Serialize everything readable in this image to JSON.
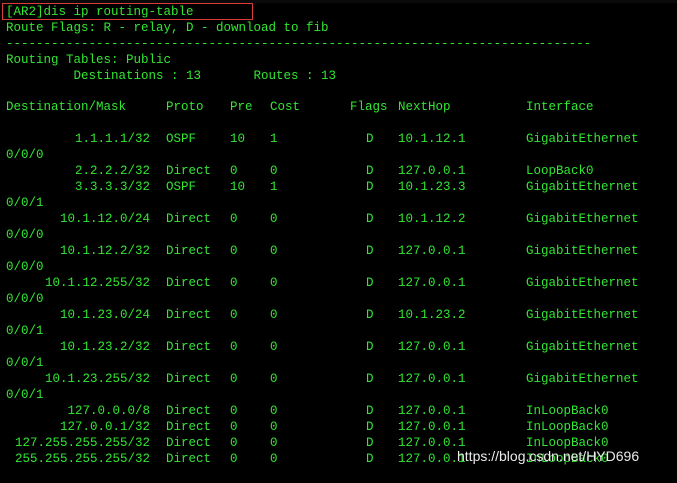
{
  "command": "[AR2]dis ip routing-table",
  "route_flags": "Route Flags: R - relay, D - download to fib",
  "separator": "------------------------------------------------------------------------------",
  "routing_tables": "Routing Tables: Public",
  "destinations_line": "         Destinations : 13       Routes : 13",
  "headers": {
    "destination": "Destination/Mask",
    "proto": "Proto",
    "pre": "Pre",
    "cost": "Cost",
    "flags": "Flags",
    "nexthop": "NextHop",
    "interface": "Interface"
  },
  "rows": [
    {
      "dest": "1.1.1.1/32",
      "proto": "OSPF",
      "pre": "10",
      "cost": "1",
      "flags": "D",
      "nexthop": "10.1.12.1",
      "iface": "GigabitEthernet",
      "cont": "0/0/0"
    },
    {
      "dest": "2.2.2.2/32",
      "proto": "Direct",
      "pre": "0",
      "cost": "0",
      "flags": "D",
      "nexthop": "127.0.0.1",
      "iface": "LoopBack0",
      "cont": ""
    },
    {
      "dest": "3.3.3.3/32",
      "proto": "OSPF",
      "pre": "10",
      "cost": "1",
      "flags": "D",
      "nexthop": "10.1.23.3",
      "iface": "GigabitEthernet",
      "cont": "0/0/1"
    },
    {
      "dest": "10.1.12.0/24",
      "proto": "Direct",
      "pre": "0",
      "cost": "0",
      "flags": "D",
      "nexthop": "10.1.12.2",
      "iface": "GigabitEthernet",
      "cont": "0/0/0"
    },
    {
      "dest": "10.1.12.2/32",
      "proto": "Direct",
      "pre": "0",
      "cost": "0",
      "flags": "D",
      "nexthop": "127.0.0.1",
      "iface": "GigabitEthernet",
      "cont": "0/0/0"
    },
    {
      "dest": "10.1.12.255/32",
      "proto": "Direct",
      "pre": "0",
      "cost": "0",
      "flags": "D",
      "nexthop": "127.0.0.1",
      "iface": "GigabitEthernet",
      "cont": "0/0/0"
    },
    {
      "dest": "10.1.23.0/24",
      "proto": "Direct",
      "pre": "0",
      "cost": "0",
      "flags": "D",
      "nexthop": "10.1.23.2",
      "iface": "GigabitEthernet",
      "cont": "0/0/1"
    },
    {
      "dest": "10.1.23.2/32",
      "proto": "Direct",
      "pre": "0",
      "cost": "0",
      "flags": "D",
      "nexthop": "127.0.0.1",
      "iface": "GigabitEthernet",
      "cont": "0/0/1"
    },
    {
      "dest": "10.1.23.255/32",
      "proto": "Direct",
      "pre": "0",
      "cost": "0",
      "flags": "D",
      "nexthop": "127.0.0.1",
      "iface": "GigabitEthernet",
      "cont": "0/0/1"
    },
    {
      "dest": "127.0.0.0/8",
      "proto": "Direct",
      "pre": "0",
      "cost": "0",
      "flags": "D",
      "nexthop": "127.0.0.1",
      "iface": "InLoopBack0",
      "cont": ""
    },
    {
      "dest": "127.0.0.1/32",
      "proto": "Direct",
      "pre": "0",
      "cost": "0",
      "flags": "D",
      "nexthop": "127.0.0.1",
      "iface": "InLoopBack0",
      "cont": ""
    },
    {
      "dest": "127.255.255.255/32",
      "proto": "Direct",
      "pre": "0",
      "cost": "0",
      "flags": "D",
      "nexthop": "127.0.0.1",
      "iface": "InLoopBack0",
      "cont": ""
    },
    {
      "dest": "255.255.255.255/32",
      "proto": "Direct",
      "pre": "0",
      "cost": "0",
      "flags": "D",
      "nexthop": "127.0.0.1",
      "iface": "InLoopBack0",
      "cont": ""
    }
  ],
  "watermark": "https://blog.csdn.net/HYD696",
  "colors": {
    "text": "#32e632",
    "background": "#000000",
    "highlight_box": "#d93a3a"
  }
}
